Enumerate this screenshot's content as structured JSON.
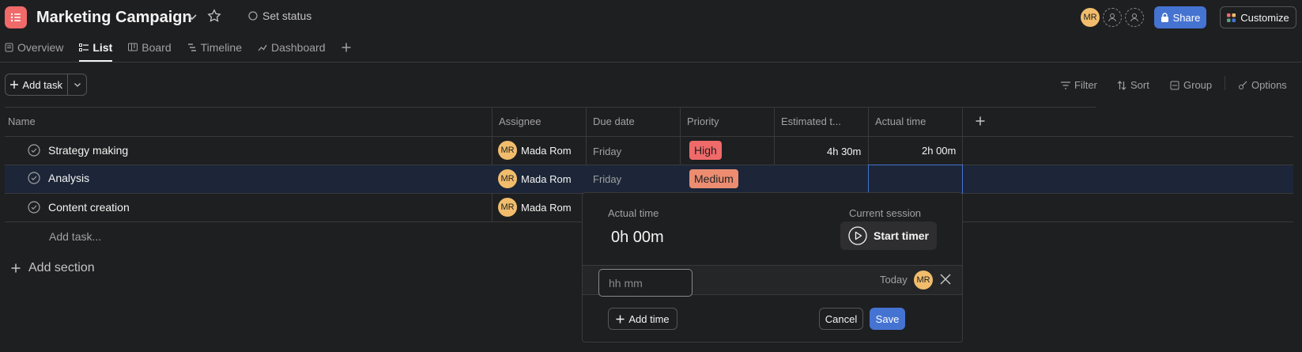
{
  "header": {
    "title": "Marketing Campaign",
    "set_status": "Set status",
    "avatar_initials": "MR",
    "share_label": "Share",
    "customize_label": "Customize"
  },
  "tabs": [
    {
      "label": "Overview",
      "icon": "overview-icon"
    },
    {
      "label": "List",
      "icon": "list-icon",
      "active": true
    },
    {
      "label": "Board",
      "icon": "board-icon"
    },
    {
      "label": "Timeline",
      "icon": "timeline-icon"
    },
    {
      "label": "Dashboard",
      "icon": "dashboard-icon"
    }
  ],
  "toolbar": {
    "add_task": "Add task",
    "filter": "Filter",
    "sort": "Sort",
    "group": "Group",
    "options": "Options"
  },
  "columns": [
    "Name",
    "Assignee",
    "Due date",
    "Priority",
    "Estimated t...",
    "Actual time"
  ],
  "tasks": [
    {
      "name": "Strategy making",
      "assignee_initials": "MR",
      "assignee": "Mada Rom",
      "due": "Friday",
      "priority": "High",
      "estimated": "4h 30m",
      "actual": "2h 00m"
    },
    {
      "name": "Analysis",
      "assignee_initials": "MR",
      "assignee": "Mada Rom",
      "due": "Friday",
      "priority": "Medium",
      "estimated": "",
      "actual": ""
    },
    {
      "name": "Content creation",
      "assignee_initials": "MR",
      "assignee": "Mada Rom",
      "due": "",
      "priority": "",
      "estimated": "",
      "actual": ""
    }
  ],
  "add_task_row": "Add task...",
  "add_section": "Add section",
  "popup": {
    "actual_time_label": "Actual time",
    "actual_time_value": "0h 00m",
    "current_session_label": "Current session",
    "start_timer": "Start timer",
    "input_placeholder": "hh mm",
    "date": "Today",
    "avatar_initials": "MR",
    "add_time": "Add time",
    "cancel": "Cancel",
    "save": "Save"
  },
  "colors": {
    "accent": "#4573d2",
    "app_icon": "#f06a6a",
    "priority_high": "#f06a6a",
    "priority_medium": "#ec8d71",
    "avatar": "#f1bd6c"
  }
}
